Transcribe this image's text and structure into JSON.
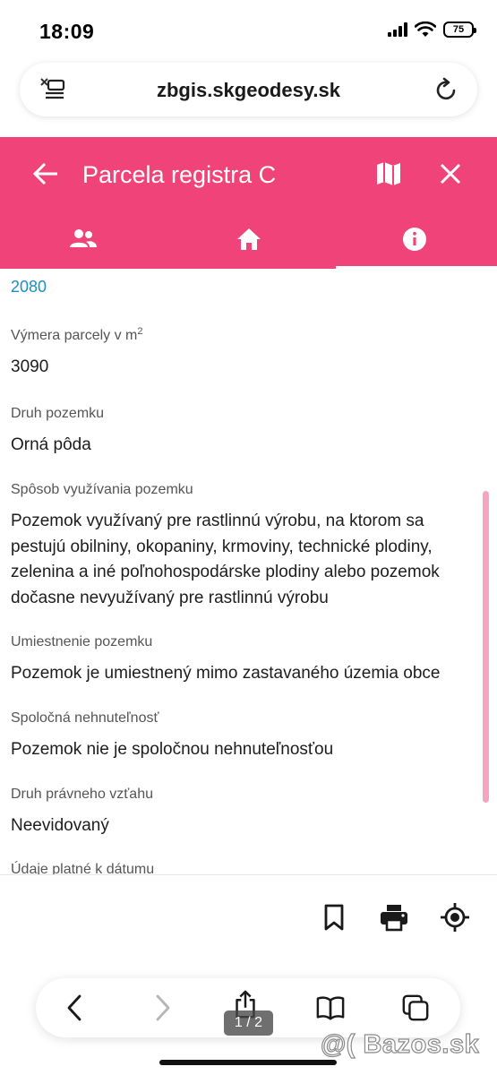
{
  "status_bar": {
    "time": "18:09",
    "battery": "75"
  },
  "url_bar": {
    "domain": "zbgis.skgeodesy.sk"
  },
  "header": {
    "title": "Parcela registra C",
    "accent_color": "#ef4379",
    "tabs": [
      {
        "icon": "people-icon",
        "active": false
      },
      {
        "icon": "home-icon",
        "active": false
      },
      {
        "icon": "info-icon",
        "active": true
      }
    ]
  },
  "content": {
    "top_value": "2080",
    "fields": [
      {
        "label": "Výmera parcely v m",
        "label_sup": "2",
        "value": "3090"
      },
      {
        "label": "Druh pozemku",
        "value": "Orná pôda"
      },
      {
        "label": "Spôsob využívania pozemku",
        "value": "Pozemok využívaný pre rastlinnú výrobu, na ktorom sa pestujú obilniny, okopaniny, krmoviny, technické plodiny, zelenina a iné poľnohospodárske plodiny alebo pozemok dočasne nevyužívaný pre rastlinnú výrobu"
      },
      {
        "label": "Umiestnenie pozemku",
        "value": "Pozemok je umiestnený mimo zastavaného územia obce"
      },
      {
        "label": "Spoločná nehnuteľnosť",
        "value": "Pozemok nie je spoločnou nehnuteľnosťou"
      },
      {
        "label": "Druh právneho vzťahu",
        "value": "Neevidovaný"
      }
    ],
    "cut_label": "Údaje platné k dátumu"
  },
  "tools": {
    "icons": [
      "bookmark-icon",
      "print-icon",
      "locate-icon"
    ]
  },
  "browser": {
    "page_indicator": "1 / 2",
    "icons": [
      "back-arrow-icon",
      "forward-arrow-icon",
      "share-icon",
      "bookmarks-icon",
      "tabs-icon"
    ]
  },
  "watermark": "@( Bazos.sk"
}
